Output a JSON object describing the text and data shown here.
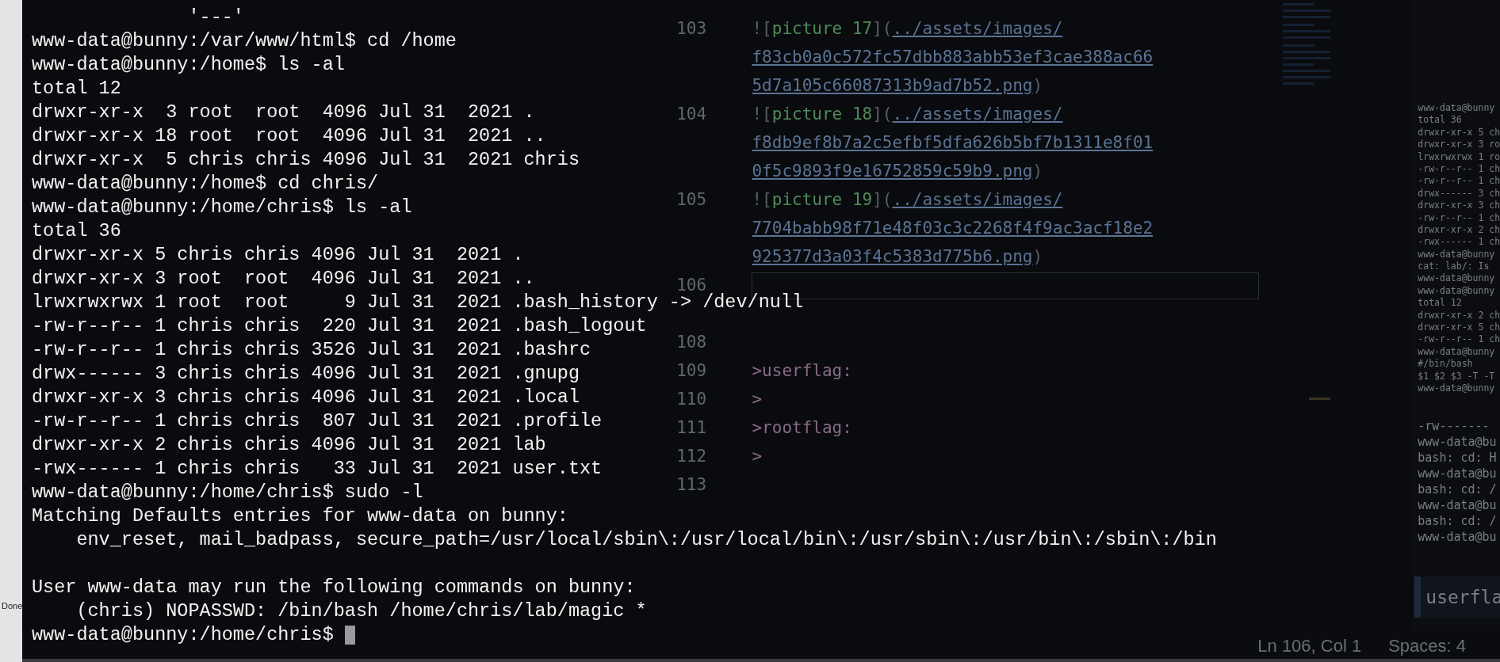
{
  "side_window": {
    "label": "Done"
  },
  "editor": {
    "lines": [
      {
        "kind": "image",
        "number": "103",
        "open": "![",
        "alt": "picture 17",
        "mid": "](",
        "path": "../assets/images/"
      },
      {
        "kind": "url",
        "text": "f83cb0a0c572fc57dbb883abb53ef3cae388ac66"
      },
      {
        "kind": "url_end",
        "text": "5d7a105c66087313b9ad7b52.png",
        "close": ")"
      },
      {
        "kind": "image",
        "number": "104",
        "open": "![",
        "alt": "picture 18",
        "mid": "](",
        "path": "../assets/images/"
      },
      {
        "kind": "url",
        "text": "f8db9ef8b7a2c5efbf5dfa626b5bf7b1311e8f01"
      },
      {
        "kind": "url_end",
        "text": "0f5c9893f9e16752859c59b9.png",
        "close": ")"
      },
      {
        "kind": "image",
        "number": "105",
        "open": "![",
        "alt": "picture 19",
        "mid": "](",
        "path": "../assets/images/"
      },
      {
        "kind": "url",
        "text": "7704babb98f71e48f03c3c2268f4f9ac3acf18e2"
      },
      {
        "kind": "url_end",
        "text": "925377d3a03f4c5383d775b6.png",
        "close": ")"
      },
      {
        "kind": "blank",
        "number": "106",
        "current": true
      },
      {
        "kind": "blank"
      },
      {
        "kind": "blank",
        "number": "108"
      },
      {
        "kind": "quote",
        "number": "109",
        "text": ">userflag:"
      },
      {
        "kind": "quote",
        "number": "110",
        "text": ">"
      },
      {
        "kind": "quote",
        "number": "111",
        "text": ">rootflag:"
      },
      {
        "kind": "quote",
        "number": "112",
        "text": ">"
      },
      {
        "kind": "blank",
        "number": "113"
      }
    ]
  },
  "other_terminal": {
    "upper": [
      "www-data@bunny",
      "total 36",
      "drwxr-xr-x 5 ch",
      "drwxr-xr-x 3 ro",
      "lrwxrwxrwx 1 ro",
      "-rw-r--r-- 1 ch",
      "-rw-r--r-- 1 ch",
      "drwx------ 3 ch",
      "drwxr-xr-x 3 ch",
      "-rw-r--r-- 1 ch",
      "drwxr-xr-x 2 ch",
      "-rwx------ 1 ch",
      "www-data@bunny",
      "cat: lab/: Is",
      "www-data@bunny",
      "www-data@bunny",
      "total 12",
      "drwxr-xr-x 2 ch",
      "drwxr-xr-x 5 ch",
      "-rw-r--r-- 1 ch",
      "www-data@bunny",
      "#/bin/bash",
      "$1 $2 $3 -T -T",
      "www-data@bunny"
    ],
    "lower": [
      "-rw-------",
      "www-data@bu",
      "bash: cd: H",
      "www-data@bu",
      "bash: cd: /",
      "www-data@bu",
      "bash: cd: /",
      "www-data@bu"
    ]
  },
  "preview_heading": "userfla",
  "status_bar": {
    "position": "Ln 106, Col 1",
    "indent": "Spaces: 4"
  },
  "terminal": {
    "cursor": true,
    "sections": [
      [
        "              '---'",
        "www-data@bunny:/var/www/html$ cd /home",
        "www-data@bunny:/home$ ls -al",
        "total 12",
        "drwxr-xr-x  3 root  root  4096 Jul 31  2021 .",
        "drwxr-xr-x 18 root  root  4096 Jul 31  2021 ..",
        "drwxr-xr-x  5 chris chris 4096 Jul 31  2021 chris",
        "www-data@bunny:/home$ cd chris/",
        "www-data@bunny:/home/chris$ ls -al",
        "total 36",
        "drwxr-xr-x 5 chris chris 4096 Jul 31  2021 .",
        "drwxr-xr-x 3 root  root  4096 Jul 31  2021 ..",
        "lrwxrwxrwx 1 root  root     9 Jul 31  2021 .bash_history -> /dev/null",
        "-rw-r--r-- 1 chris chris  220 Jul 31  2021 .bash_logout",
        "-rw-r--r-- 1 chris chris 3526 Jul 31  2021 .bashrc",
        "drwx------ 3 chris chris 4096 Jul 31  2021 .gnupg",
        "drwxr-xr-x 3 chris chris 4096 Jul 31  2021 .local",
        "-rw-r--r-- 1 chris chris  807 Jul 31  2021 .profile",
        "drwxr-xr-x 2 chris chris 4096 Jul 31  2021 lab",
        "-rwx------ 1 chris chris   33 Jul 31  2021 user.txt",
        "www-data@bunny:/home/chris$ sudo -l",
        "Matching Defaults entries for www-data on bunny:",
        "    env_reset, mail_badpass, secure_path=/usr/local/sbin\\:/usr/local/bin\\:/usr/sbin\\:/usr/bin\\:/sbin\\:/bin"
      ],
      [
        "User www-data may run the following commands on bunny:",
        "    (chris) NOPASSWD: /bin/bash /home/chris/lab/magic *",
        "www-data@bunny:/home/chris$ "
      ]
    ]
  }
}
